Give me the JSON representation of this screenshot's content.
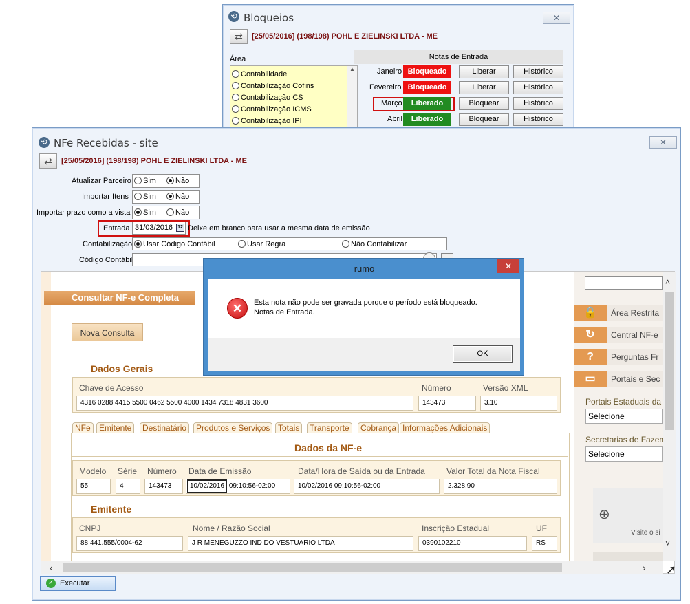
{
  "bloqueios": {
    "title": "Bloqueios",
    "close": "✕",
    "company": "[25/05/2016] (198/198) POHL E ZIELINSKI LTDA - ME",
    "area_label": "Área",
    "areas": [
      "Contabilidade",
      "Contabilização Cofins",
      "Contabilização CS",
      "Contabilização ICMS",
      "Contabilização IPI"
    ],
    "notas_header": "Notas de Entrada",
    "months": [
      {
        "name": "Janeiro",
        "status": "Bloqueado",
        "action": "Liberar",
        "hist": "Histórico"
      },
      {
        "name": "Fevereiro",
        "status": "Bloqueado",
        "action": "Liberar",
        "hist": "Histórico"
      },
      {
        "name": "Março",
        "status": "Liberado",
        "action": "Bloquear",
        "hist": "Histórico"
      },
      {
        "name": "Abril",
        "status": "Liberado",
        "action": "Bloquear",
        "hist": "Histórico"
      }
    ],
    "colors": {
      "blocked": "#ee1111",
      "released": "#228b22"
    }
  },
  "nfe": {
    "title": "NFe Recebidas - site",
    "close": "✕",
    "company": "[25/05/2016] (198/198) POHL E ZIELINSKI LTDA - ME",
    "atualizar_label": "Atualizar Parceiro",
    "importar_itens_label": "Importar Itens",
    "importar_prazo_label": "Importar prazo como a vista",
    "sim": "Sim",
    "nao": "Não",
    "entrada_label": "Entrada",
    "entrada_value": "31/03/2016",
    "entrada_hint": "Deixe em branco para usar a mesma data de emissão",
    "contab_label": "Contabilização",
    "contab_options": [
      "Usar Código Contábil",
      "Usar Regra",
      "Não Contabilizar"
    ],
    "codigo_label": "Código Contábil",
    "executar": "Executar"
  },
  "web": {
    "consultar": "Consultar NF-e Completa",
    "nova_consulta": "Nova Consulta",
    "dados_gerais": "Dados Gerais",
    "chave_label": "Chave de Acesso",
    "chave_value": "4316 0288 4415 5500 0462 5500 4000 1434 7318 4831 3600",
    "numero_label": "Número",
    "numero_value": "143473",
    "versao_label": "Versão XML",
    "versao_value": "3.10",
    "tabs": [
      "NFe",
      "Emitente",
      "Destinatário",
      "Produtos e Serviços",
      "Totais",
      "Transporte",
      "Cobrança",
      "Informações Adicionais"
    ],
    "dados_nfe": "Dados da NF-e",
    "modelo_label": "Modelo",
    "modelo_value": "55",
    "serie_label": "Série",
    "serie_value": "4",
    "num2_label": "Número",
    "num2_value": "143473",
    "emissao_label": "Data de Emissão",
    "emissao_date": "10/02/2016",
    "emissao_time": "09:10:56-02:00",
    "saida_label": "Data/Hora de Saída ou da Entrada",
    "saida_value": "10/02/2016 09:10:56-02:00",
    "valor_label": "Valor Total da Nota Fiscal",
    "valor_value": "2.328,90",
    "emitente": "Emitente",
    "cnpj_label": "CNPJ",
    "cnpj_value": "88.441.555/0004-62",
    "nome_label": "Nome / Razão Social",
    "nome_value": "J R MENEGUZZO IND DO VESTUARIO LTDA",
    "ie_label": "Inscrição Estadual",
    "ie_value": "0390102210",
    "uf_label": "UF",
    "uf_value": "RS",
    "side": {
      "area_restrita": "Área Restrita",
      "central": "Central NF-e",
      "perguntas": "Perguntas Fr",
      "portais": "Portais e Sec",
      "portais_estaduais": "Portais Estaduais da",
      "selecione1": "Selecione",
      "secretarias": "Secretarias de Fazen",
      "selecione2": "Selecione",
      "visite": "Visite o si"
    }
  },
  "dialog": {
    "title": "rumo",
    "close": "✕",
    "message1": "Esta nota não pode ser gravada porque o período está bloqueado.",
    "message2": "Notas de Entrada.",
    "ok": "OK"
  }
}
